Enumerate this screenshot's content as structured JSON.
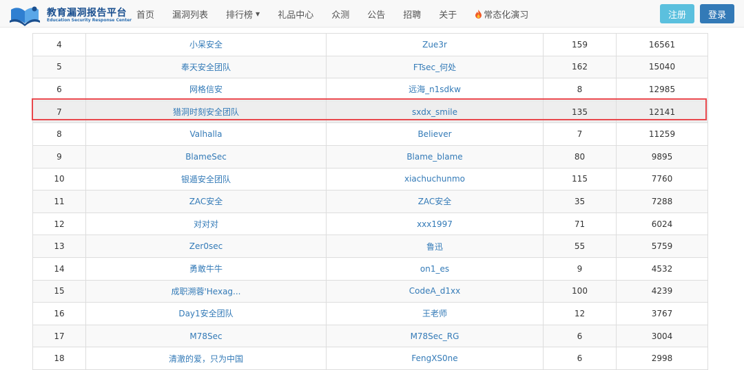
{
  "header": {
    "logo_cn": "教育漏洞报告平台",
    "logo_en": "Education Security Response Center",
    "nav": [
      {
        "label": "首页",
        "name": "nav-home"
      },
      {
        "label": "漏洞列表",
        "name": "nav-vuln-list"
      },
      {
        "label": "排行榜",
        "name": "nav-ranking",
        "dropdown": true
      },
      {
        "label": "礼品中心",
        "name": "nav-gift-center"
      },
      {
        "label": "众测",
        "name": "nav-crowdtest"
      },
      {
        "label": "公告",
        "name": "nav-announcement"
      },
      {
        "label": "招聘",
        "name": "nav-recruit"
      },
      {
        "label": "关于",
        "name": "nav-about"
      },
      {
        "label": "常态化演习",
        "name": "nav-drill",
        "icon": "fire-icon"
      }
    ],
    "register_label": "注册",
    "login_label": "登录"
  },
  "colors": {
    "link": "#337ab7",
    "register_btn": "#5bc0de",
    "login_btn": "#337ab7",
    "highlight_border": "#e8474c"
  },
  "ranking": {
    "highlighted_rank": "7",
    "rows": [
      {
        "rank": "4",
        "team": "小呆安全",
        "user": "Zue3r",
        "count": "159",
        "score": "16561"
      },
      {
        "rank": "5",
        "team": "奉天安全团队",
        "user": "FTsec_何处",
        "count": "162",
        "score": "15040"
      },
      {
        "rank": "6",
        "team": "网格信安",
        "user": "远海_n1sdkw",
        "count": "8",
        "score": "12985"
      },
      {
        "rank": "7",
        "team": "猎洞时刻安全团队",
        "user": "sxdx_smile",
        "count": "135",
        "score": "12141"
      },
      {
        "rank": "8",
        "team": "Valhalla",
        "user": "Believer",
        "count": "7",
        "score": "11259"
      },
      {
        "rank": "9",
        "team": "BlameSec",
        "user": "Blame_blame",
        "count": "80",
        "score": "9895"
      },
      {
        "rank": "10",
        "team": "银遁安全团队",
        "user": "xiachuchunmo",
        "count": "115",
        "score": "7760"
      },
      {
        "rank": "11",
        "team": "ZAC安全",
        "user": "ZAC安全",
        "count": "35",
        "score": "7288"
      },
      {
        "rank": "12",
        "team": "对对对",
        "user": "xxx1997",
        "count": "71",
        "score": "6024"
      },
      {
        "rank": "13",
        "team": "Zer0sec",
        "user": "鲁迅",
        "count": "55",
        "score": "5759"
      },
      {
        "rank": "14",
        "team": "勇敢牛牛",
        "user": "on1_es",
        "count": "9",
        "score": "4532"
      },
      {
        "rank": "15",
        "team": "成职溯蓉'Hexag...",
        "user": "CodeA_d1xx",
        "count": "100",
        "score": "4239"
      },
      {
        "rank": "16",
        "team": "Day1安全团队",
        "user": "王老师",
        "count": "12",
        "score": "3767"
      },
      {
        "rank": "17",
        "team": "M78Sec",
        "user": "M78Sec_RG",
        "count": "6",
        "score": "3004"
      },
      {
        "rank": "18",
        "team": "清澈的爱，只为中国",
        "user": "FengXS0ne",
        "count": "6",
        "score": "2998"
      }
    ]
  }
}
